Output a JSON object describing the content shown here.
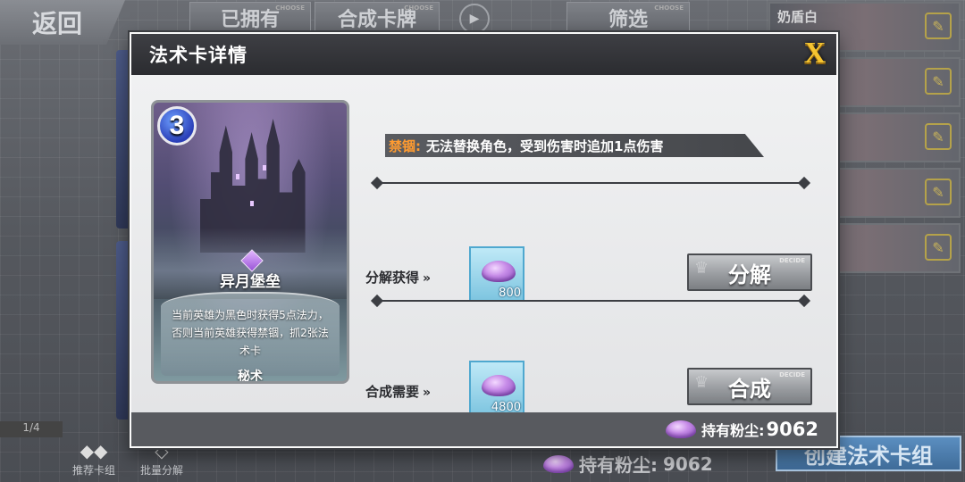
{
  "background": {
    "back_label": "返回",
    "tabs": [
      {
        "label": "已拥有",
        "sub": "CHOOSE"
      },
      {
        "label": "合成卡牌",
        "sub": "CHOOSE"
      },
      {
        "label": "筛选",
        "sub": "CHOOSE"
      }
    ],
    "decks": [
      {
        "name": "奶盾白"
      },
      {
        "name": ""
      },
      {
        "name": ""
      },
      {
        "name": ""
      },
      {
        "name": ""
      }
    ],
    "page_indicator": "1/4",
    "bottom_buttons": [
      {
        "label": "推荐卡组"
      },
      {
        "label": "批量分解"
      }
    ],
    "dust_label": "持有粉尘:",
    "dust_value": "9062",
    "create_deck_label": "创建法术卡组"
  },
  "modal": {
    "title": "法术卡详情",
    "close_label": "X",
    "card": {
      "cost": "3",
      "name": "异月堡垒",
      "description": "当前英雄为黑色时获得5点法力，否则当前英雄获得禁锢，抓2张法术卡",
      "type": "秘术"
    },
    "ban": {
      "key": "禁锢:",
      "value": "无法替换角色，受到伤害时追加1点伤害"
    },
    "decompose": {
      "label": "分解获得",
      "amount": "800",
      "button": "分解",
      "button_sub": "DECIDE"
    },
    "compose": {
      "label": "合成需要",
      "amount": "4800",
      "button": "合成",
      "button_sub": "DECIDE"
    },
    "footer": {
      "dust_label": "持有粉尘:",
      "dust_value": "9062"
    }
  },
  "colors": {
    "ban_key": "#ff9b30",
    "close_x": "#f5c431",
    "dust_box": "#7ec5e0",
    "header": "#2b2c30"
  }
}
